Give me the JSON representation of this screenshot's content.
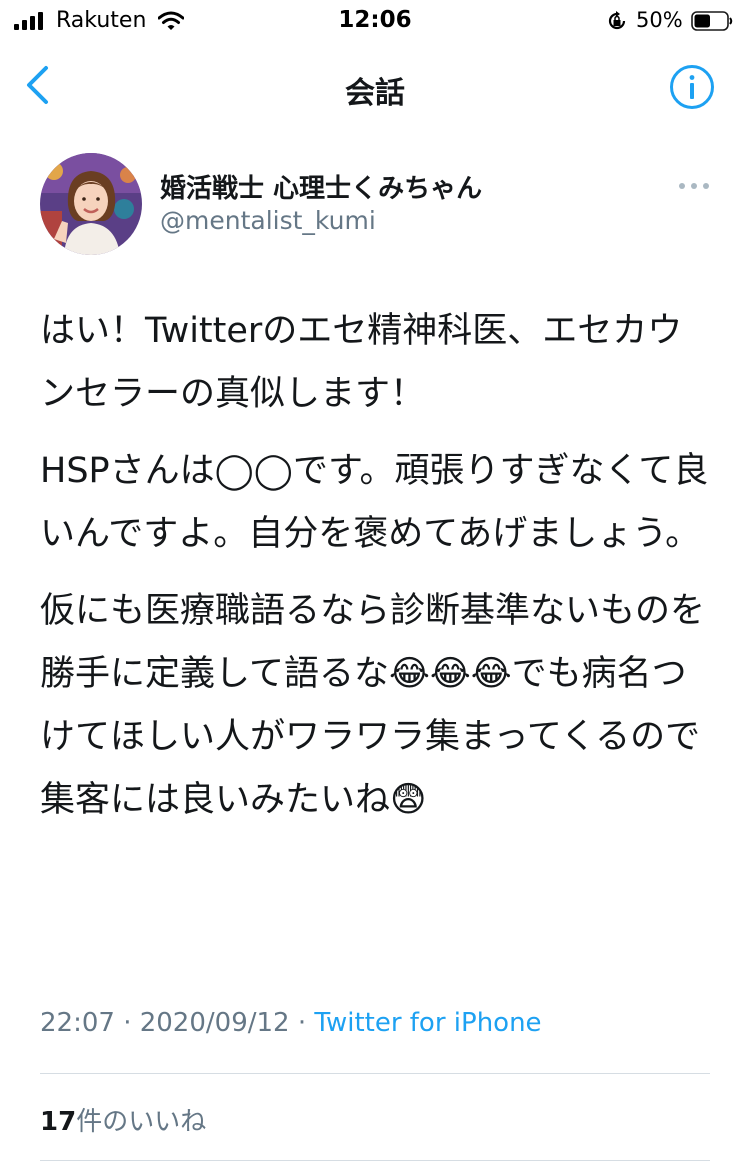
{
  "status_bar": {
    "carrier": "Rakuten",
    "time": "12:06",
    "battery_percent": "50%",
    "battery_level": 0.5
  },
  "nav": {
    "title": "会話",
    "back_icon": "chevron-left-icon",
    "info_icon": "info-circle-icon"
  },
  "tweet": {
    "display_name": "婚活戦士 心理士くみちゃん",
    "handle": "@mentalist_kumi",
    "paragraphs": [
      "はい！Twitterのエセ精神科医、エセカウンセラーの真似します！",
      "HSPさんは◯◯です。頑張りすぎなくて良いんですよ。自分を褒めてあげましょう。",
      "仮にも医療職語るなら診断基準ないものを勝手に定義して語るな😂😂😂でも病名つけてほしい人がワラワラ集まってくるので集客には良いみたいね😨"
    ],
    "timestamp": "22:07 · 2020/09/12 · ",
    "source": "Twitter for iPhone",
    "likes_count": "17",
    "likes_label": "件のいいね"
  },
  "colors": {
    "accent": "#1da1f2",
    "text": "#14171a",
    "secondary": "#657786",
    "divider": "#d6dde3"
  }
}
